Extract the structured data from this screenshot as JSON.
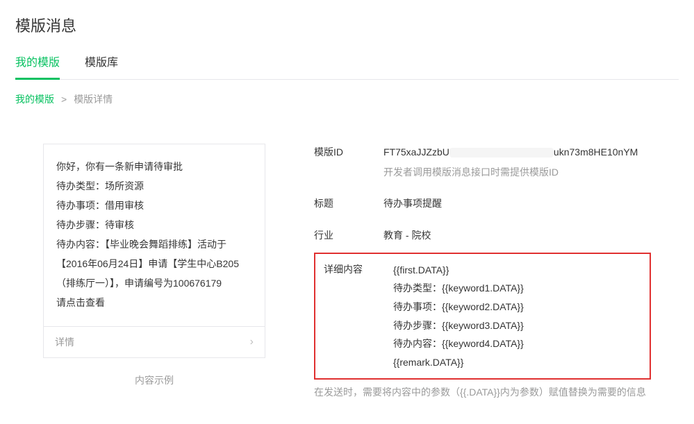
{
  "header": {
    "title": "模版消息"
  },
  "tabs": {
    "my": "我的模版",
    "library": "模版库"
  },
  "breadcrumb": {
    "root": "我的模版",
    "sep": ">",
    "current": "模版详情"
  },
  "preview": {
    "greeting": "你好，你有一条新申请待审批",
    "line_type": "待办类型：场所资源",
    "line_item": "待办事项：借用审核",
    "line_step": "待办步骤：待审核",
    "line_content": "待办内容：【毕业晚会舞蹈排练】活动于【2016年06月24日】申请【学生中心B205（排练厅一）】，申请编号为100676179",
    "line_action": "请点击查看",
    "footer": "详情",
    "example_label": "内容示例"
  },
  "info": {
    "id_label": "模版ID",
    "id_value_prefix": "FT75xaJJZzbU",
    "id_value_suffix": "ukn73m8HE10nYM",
    "id_note": "开发者调用模版消息接口时需提供模版ID",
    "title_label": "标题",
    "title_value": "待办事项提醒",
    "industry_label": "行业",
    "industry_value": "教育 - 院校",
    "detail_label": "详细内容",
    "detail_lines": {
      "l1": "{{first.DATA}}",
      "l2": "待办类型：{{keyword1.DATA}}",
      "l3": "待办事项：{{keyword2.DATA}}",
      "l4": "待办步骤：{{keyword3.DATA}}",
      "l5": "待办内容：{{keyword4.DATA}}",
      "l6": "{{remark.DATA}}"
    },
    "footer_note": "在发送时，需要将内容中的参数（{{.DATA}}内为参数）赋值替换为需要的信息"
  }
}
